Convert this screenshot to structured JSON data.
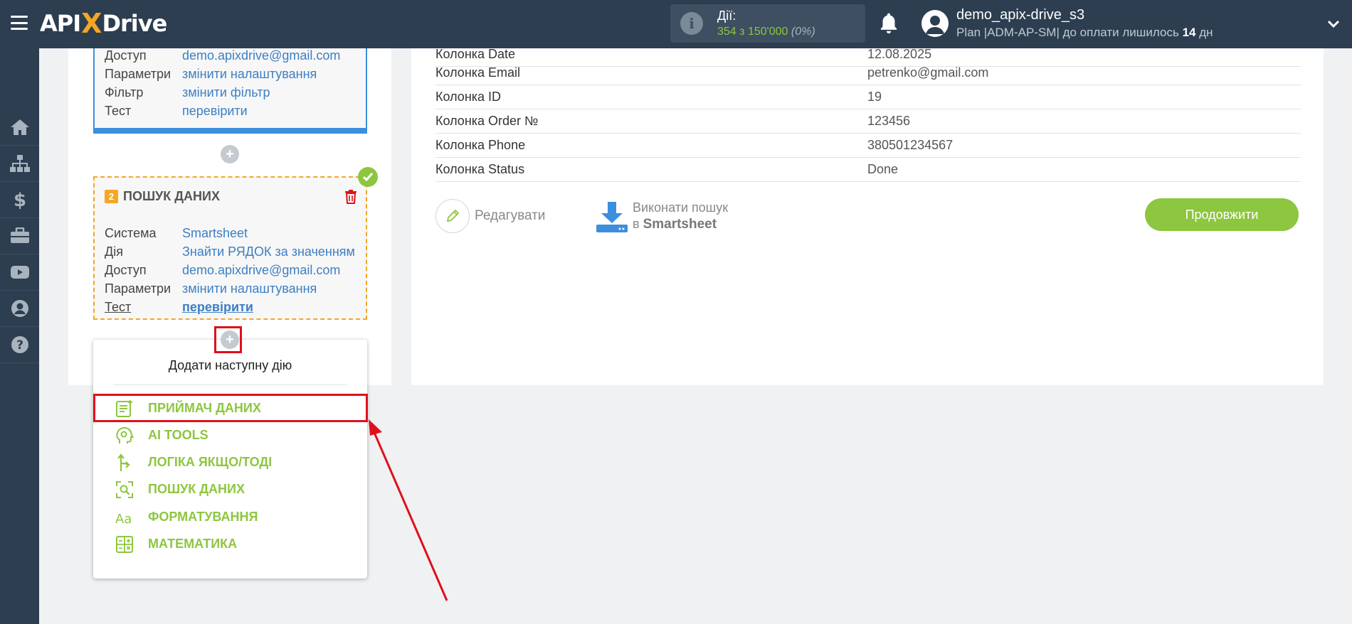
{
  "header": {
    "logo": {
      "part1": "API",
      "part2": "X",
      "part3": "Drive"
    },
    "actions": {
      "label": "Дії:",
      "used": "354",
      "of": "з",
      "limit": "150'000",
      "percent": "(0%)"
    },
    "user": {
      "name": "demo_apix-drive_s3",
      "plan_prefix": "Plan |ADM-AP-SM| до оплати лишилось",
      "days": "14",
      "days_unit": "дн"
    }
  },
  "sidebar": {
    "items": [
      {
        "icon": "home-icon"
      },
      {
        "icon": "sitemap-icon"
      },
      {
        "icon": "dollar-icon"
      },
      {
        "icon": "briefcase-icon"
      },
      {
        "icon": "youtube-icon"
      },
      {
        "icon": "user-circle-icon"
      },
      {
        "icon": "help-icon"
      }
    ]
  },
  "block1": {
    "rows": [
      {
        "key": "Доступ",
        "value": "demo.apixdrive@gmail.com"
      },
      {
        "key": "Параметри",
        "value": "змінити налаштування"
      },
      {
        "key": "Фільтр",
        "value": "змінити фільтр"
      },
      {
        "key": "Тест",
        "value": "перевірити"
      }
    ]
  },
  "block2": {
    "number": "2",
    "title": "ПОШУК ДАНИХ",
    "rows": [
      {
        "key": "Система",
        "value": "Smartsheet"
      },
      {
        "key": "Дія",
        "value": "Знайти РЯДОК за значенням"
      },
      {
        "key": "Доступ",
        "value": "demo.apixdrive@gmail.com"
      },
      {
        "key": "Параметри",
        "value": "змінити налаштування"
      },
      {
        "key": "Тест",
        "value": "перевірити"
      }
    ]
  },
  "popup": {
    "title": "Додати наступну дію",
    "items": [
      {
        "label": "ПРИЙМАЧ ДАНИХ",
        "icon": "receiver-list-icon"
      },
      {
        "label": "AI TOOLS",
        "icon": "ai-head-icon"
      },
      {
        "label": "ЛОГІКА ЯКЩО/ТОДІ",
        "icon": "branch-arrow-icon"
      },
      {
        "label": "ПОШУК ДАНИХ",
        "icon": "search-data-icon"
      },
      {
        "label": "ФОРМАТУВАННЯ",
        "icon": "font-format-icon"
      },
      {
        "label": "МАТЕМАТИКА",
        "icon": "calculator-icon"
      }
    ]
  },
  "results": {
    "rows": [
      {
        "key": "Колонка Date",
        "value": "12.08.2025"
      },
      {
        "key": "Колонка Email",
        "value": "petrenko@gmail.com"
      },
      {
        "key": "Колонка ID",
        "value": "19"
      },
      {
        "key": "Колонка Order №",
        "value": "123456"
      },
      {
        "key": "Колонка Phone",
        "value": "380501234567"
      },
      {
        "key": "Колонка Status",
        "value": "Done"
      }
    ],
    "edit_label": "Редагувати",
    "search_line1": "Виконати пошук",
    "search_prefix": "в",
    "search_system": "Smartsheet",
    "continue_label": "Продовжити"
  },
  "colors": {
    "accent_green": "#8dc63f",
    "brand_orange": "#f5a623",
    "link_blue": "#3c7fc4",
    "highlight_red": "#e0101a",
    "nav_dark": "#2c3e50"
  }
}
